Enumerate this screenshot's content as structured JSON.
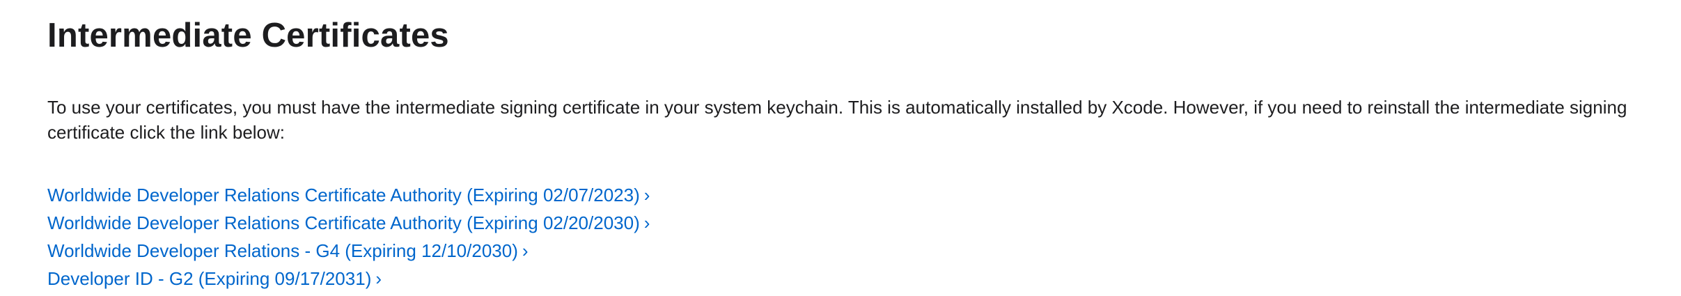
{
  "section": {
    "title": "Intermediate Certificates",
    "description": "To use your certificates, you must have the intermediate signing certificate in your system keychain. This is automatically installed by Xcode. However, if you need to reinstall the intermediate signing certificate click the link below:"
  },
  "links": [
    {
      "label": "Worldwide Developer Relations Certificate Authority (Expiring 02/07/2023)",
      "icon": "›"
    },
    {
      "label": "Worldwide Developer Relations Certificate Authority (Expiring 02/20/2030)",
      "icon": "›"
    },
    {
      "label": "Worldwide Developer Relations - G4 (Expiring 12/10/2030)",
      "icon": "›"
    },
    {
      "label": "Developer ID - G2 (Expiring 09/17/2031)",
      "icon": "›"
    }
  ],
  "colors": {
    "link": "#0066cc",
    "text": "#1d1d1f",
    "background": "#ffffff"
  }
}
